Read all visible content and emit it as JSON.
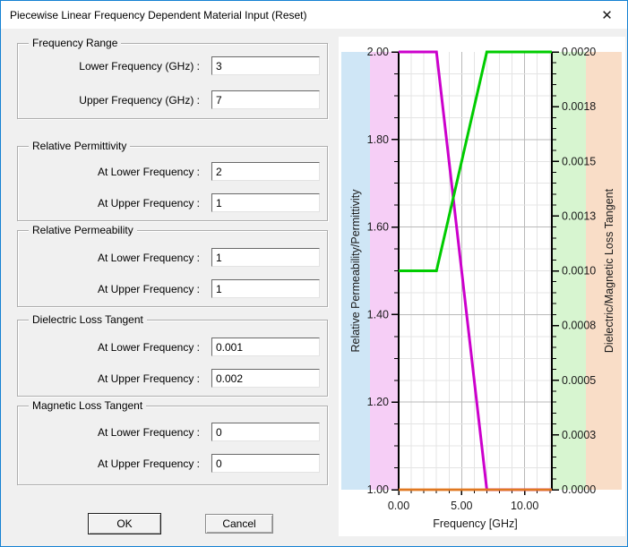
{
  "window": {
    "title": "Piecewise Linear Frequency Dependent Material Input (Reset)",
    "close_glyph": "✕",
    "border_color": "#1581d3"
  },
  "form": {
    "groups": [
      {
        "title": "Frequency Range",
        "fields": [
          {
            "label": "Lower Frequency (GHz) :",
            "value": "3"
          },
          {
            "label": "Upper Frequency (GHz) :",
            "value": "7"
          }
        ]
      },
      {
        "title": "Relative Permittivity",
        "fields": [
          {
            "label": "At Lower Frequency :",
            "value": "2"
          },
          {
            "label": "At Upper Frequency :",
            "value": "1"
          }
        ]
      },
      {
        "title": "Relative Permeability",
        "fields": [
          {
            "label": "At Lower Frequency :",
            "value": "1"
          },
          {
            "label": "At Upper Frequency :",
            "value": "1"
          }
        ]
      },
      {
        "title": "Dielectric Loss Tangent",
        "fields": [
          {
            "label": "At Lower Frequency :",
            "value": "0.001"
          },
          {
            "label": "At Upper Frequency :",
            "value": "0.002"
          }
        ]
      },
      {
        "title": "Magnetic Loss Tangent",
        "fields": [
          {
            "label": "At Lower Frequency :",
            "value": "0"
          },
          {
            "label": "At Upper Frequency :",
            "value": "0"
          }
        ]
      }
    ],
    "buttons": {
      "ok": "OK",
      "cancel": "Cancel"
    }
  },
  "chart_data": {
    "type": "line",
    "x_axis": {
      "title": "Frequency [GHz]",
      "min": 0,
      "max": 12.16,
      "tick_labels": [
        {
          "value": 0,
          "label": "0.00"
        },
        {
          "value": 5,
          "label": "5.00"
        },
        {
          "value": 10,
          "label": "10.00"
        }
      ],
      "minor_tick_step": 1
    },
    "left_axis": {
      "title": "Relative Permeability/Permittivity",
      "min": 1,
      "max": 2,
      "tick_labels": [
        {
          "value": 2.0,
          "label": "2.00"
        },
        {
          "value": 1.8,
          "label": "1.80"
        },
        {
          "value": 1.6,
          "label": "1.60"
        },
        {
          "value": 1.4,
          "label": "1.40"
        },
        {
          "value": 1.2,
          "label": "1.20"
        },
        {
          "value": 1.0,
          "label": "1.00"
        }
      ],
      "minor_tick_step": 0.05
    },
    "right_axis": {
      "title": "Dielectric/Magnetic Loss Tangent",
      "min": 0,
      "max": 0.002,
      "tick_labels": [
        {
          "value": 0.002,
          "label": "0.0020"
        },
        {
          "value": 0.00175,
          "label": "0.0018"
        },
        {
          "value": 0.0015,
          "label": "0.0015"
        },
        {
          "value": 0.00125,
          "label": "0.0013"
        },
        {
          "value": 0.001,
          "label": "0.0010"
        },
        {
          "value": 0.00075,
          "label": "0.0008"
        },
        {
          "value": 0.0005,
          "label": "0.0005"
        },
        {
          "value": 0.00025,
          "label": "0.0003"
        },
        {
          "value": 0.0,
          "label": "0.0000"
        }
      ],
      "minor_tick_step": 5e-05
    },
    "background_bands": [
      {
        "name": "left-title-band",
        "color": "#cfe6f6"
      },
      {
        "name": "left-labels-band",
        "color": "#f6cef6"
      },
      {
        "name": "right-labels-band",
        "color": "#d7f5d0"
      },
      {
        "name": "right-title-band",
        "color": "#f9ddc7"
      }
    ],
    "grid": {
      "minor_color": "#e4e4e4",
      "major_color": "#b9b9b9"
    },
    "series": [
      {
        "name": "Relative Permittivity",
        "axis": "left",
        "color": "#cc00cc",
        "width": 3,
        "points": [
          [
            0,
            2
          ],
          [
            3,
            2
          ],
          [
            7,
            1
          ],
          [
            12.16,
            1
          ]
        ]
      },
      {
        "name": "Dielectric Loss Tangent",
        "axis": "right",
        "color": "#00cc00",
        "width": 3,
        "points": [
          [
            0,
            0.001
          ],
          [
            3,
            0.001
          ],
          [
            7,
            0.002
          ],
          [
            12.16,
            0.002
          ]
        ]
      },
      {
        "name": "Relative Permeability",
        "axis": "left",
        "color": "#e07820",
        "width": 2.5,
        "points": [
          [
            0,
            1
          ],
          [
            12.16,
            1
          ]
        ]
      },
      {
        "name": "Magnetic Loss Tangent",
        "axis": "right",
        "color": "#e07820",
        "width": 2.5,
        "points": [
          [
            0,
            0
          ],
          [
            12.16,
            0
          ]
        ]
      }
    ]
  }
}
